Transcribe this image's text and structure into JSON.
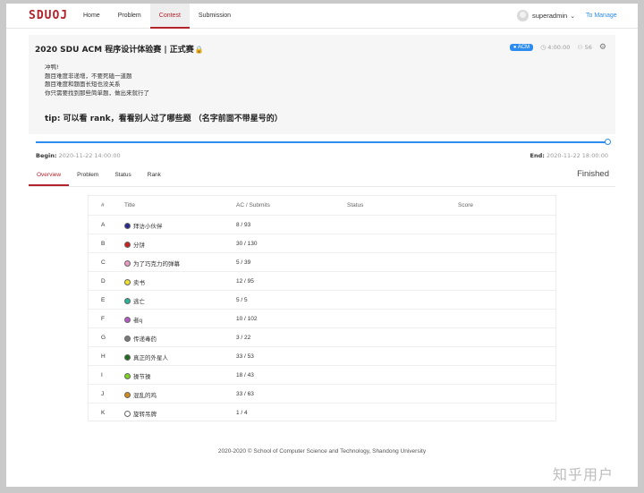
{
  "header": {
    "logo": "SDUOJ",
    "nav": [
      "Home",
      "Problem",
      "Contest",
      "Submission"
    ],
    "active_nav": "Contest",
    "username": "superadmin",
    "manage_link": "To Manage"
  },
  "contest": {
    "title": "2020 SDU ACM 程序设计体验赛 | 正式赛",
    "mode_tag": "ACM",
    "duration": "4:00:00",
    "participants": "56",
    "description": [
      "冲鸭!",
      "题目难度非递增，不要死磕一道题",
      "题目难度和题面长短也没关系",
      "你只需要找到那些简单题，做出来就行了"
    ],
    "tip": "tip: 可以看 rank，看看别人过了哪些题 （名字前面不带星号的）",
    "begin_label": "Begin:",
    "begin_time": "2020-11-22 14:00:00",
    "end_label": "End:",
    "end_time": "2020-11-22 18:00:00",
    "progress": 1.0,
    "status": "Finished"
  },
  "tabs": [
    "Overview",
    "Problem",
    "Status",
    "Rank"
  ],
  "active_tab": "Overview",
  "table": {
    "headers": [
      "#",
      "Title",
      "AC / Submits",
      "Status",
      "Score"
    ],
    "rows": [
      {
        "id": "A",
        "title": "拜访小伙伴",
        "ac": "8 / 93",
        "color": "#2b2a8c"
      },
      {
        "id": "B",
        "title": "分饼",
        "ac": "30 / 130",
        "color": "#cc1f1f"
      },
      {
        "id": "C",
        "title": "为了巧克力的弹幕",
        "ac": "5 / 39",
        "color": "#e89bc3"
      },
      {
        "id": "D",
        "title": "卖书",
        "ac": "12 / 95",
        "color": "#f0e12a"
      },
      {
        "id": "E",
        "title": "逃亡",
        "ac": "5 / 5",
        "color": "#27b398"
      },
      {
        "id": "F",
        "title": "者q",
        "ac": "10 / 102",
        "color": "#b35ac4"
      },
      {
        "id": "G",
        "title": "传递毒药",
        "ac": "3 / 22",
        "color": "#7a7a7a"
      },
      {
        "id": "H",
        "title": "真正的外星人",
        "ac": "33 / 53",
        "color": "#1f6e1f"
      },
      {
        "id": "I",
        "title": "操节操",
        "ac": "18 / 43",
        "color": "#7ed321"
      },
      {
        "id": "J",
        "title": "混乱的鸡",
        "ac": "33 / 63",
        "color": "#d18a1c"
      },
      {
        "id": "K",
        "title": "旋转吊牌",
        "ac": "1 / 4",
        "color": "#ffffff"
      }
    ]
  },
  "footer": "2020-2020 © School of Computer Science and Technology, Shandong University",
  "watermark": "知乎用户"
}
